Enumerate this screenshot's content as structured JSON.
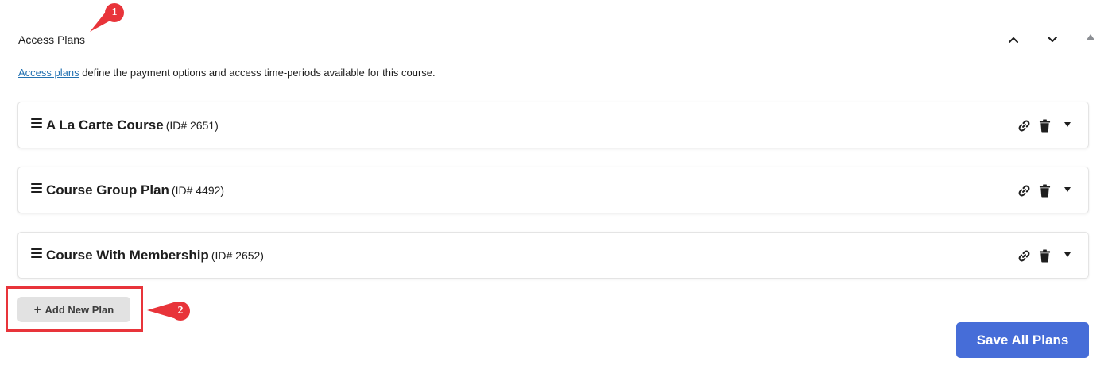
{
  "panel": {
    "title": "Access Plans",
    "description_link": "Access plans",
    "description_rest": " define the payment options and access time-periods available for this course."
  },
  "plans": [
    {
      "name": "A La Carte Course",
      "id_label": "(ID# 2651)"
    },
    {
      "name": "Course Group Plan",
      "id_label": "(ID# 4492)"
    },
    {
      "name": "Course With Membership",
      "id_label": "(ID# 2652)"
    }
  ],
  "buttons": {
    "add_plus": "+",
    "add_new_plan": "Add New Plan",
    "save_all": "Save All Plans"
  },
  "callouts": {
    "one": "1",
    "two": "2"
  },
  "icons": {
    "move_up": "chevron-up-icon",
    "move_down": "chevron-down-icon",
    "toggle": "triangle-up-icon",
    "drag": "drag-handle-icon",
    "link": "link-icon",
    "delete": "trash-icon",
    "expand": "caret-down-icon"
  },
  "colors": {
    "link": "#2271b1",
    "primary_button": "#466dd8",
    "secondary_button": "#e2e2e2",
    "annotation": "#e8343a"
  }
}
